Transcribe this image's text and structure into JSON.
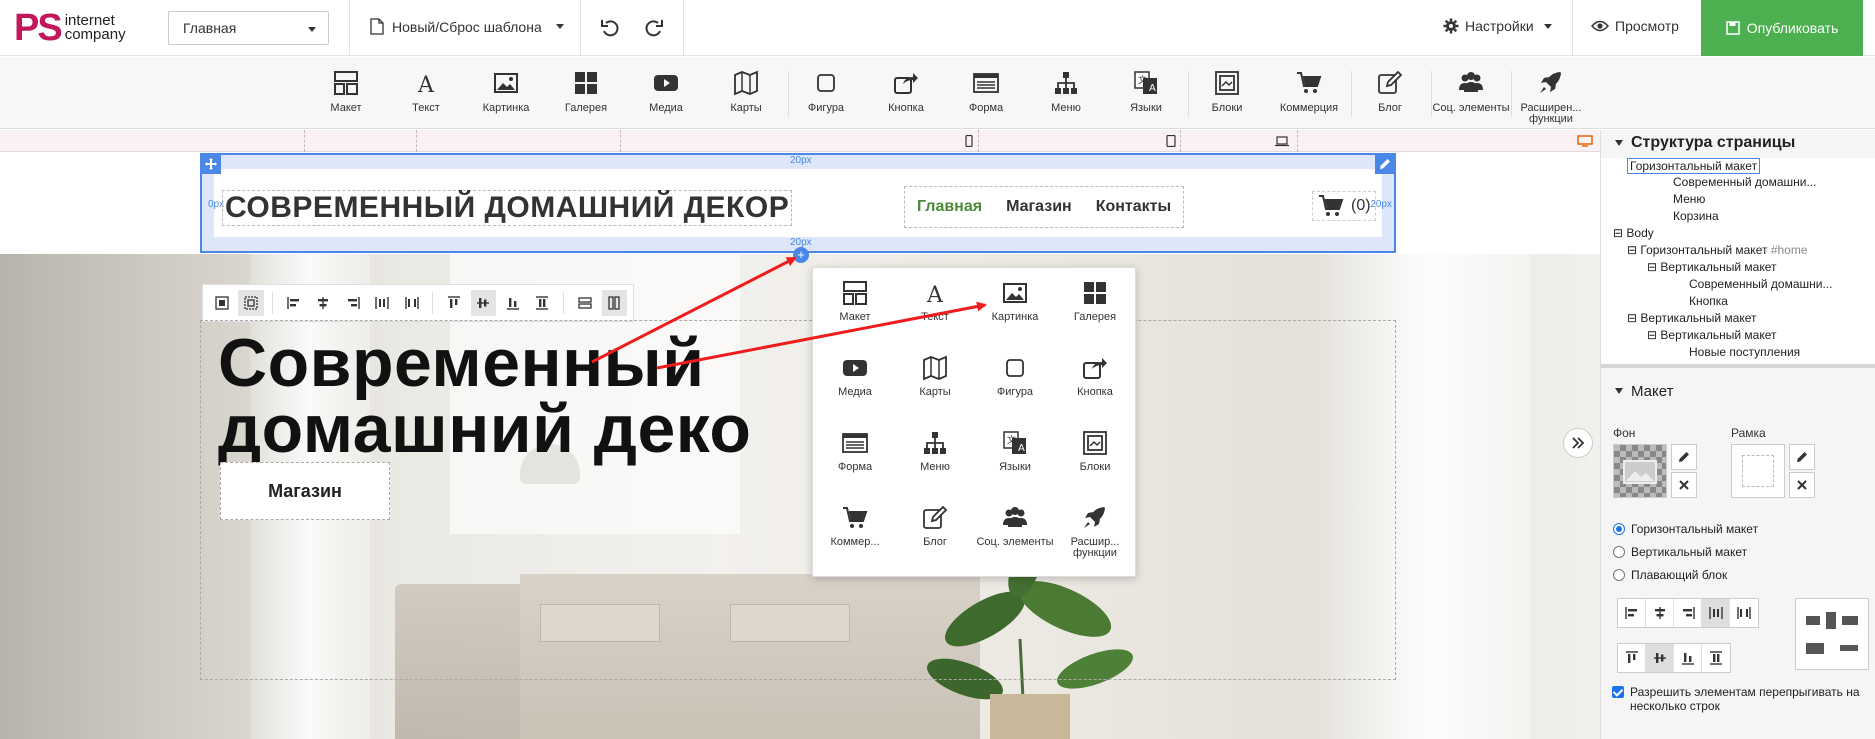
{
  "logo": {
    "mark": "PS",
    "line1": "internet",
    "line2": "company"
  },
  "topbar": {
    "page_select": "Главная",
    "template_label": "Новый/Сброс шаблона",
    "settings_label": "Настройки",
    "preview_label": "Просмотр",
    "publish_label": "Опубликовать"
  },
  "toolbar": {
    "items": [
      {
        "label": "Макет",
        "icon": "layout-icon"
      },
      {
        "label": "Текст",
        "icon": "text-icon"
      },
      {
        "label": "Картинка",
        "icon": "image-icon"
      },
      {
        "label": "Галерея",
        "icon": "gallery-icon"
      },
      {
        "label": "Медиа",
        "icon": "media-icon"
      },
      {
        "label": "Карты",
        "icon": "map-icon"
      },
      {
        "label": "Фигура",
        "icon": "shape-icon"
      },
      {
        "label": "Кнопка",
        "icon": "button-icon"
      },
      {
        "label": "Форма",
        "icon": "form-icon"
      },
      {
        "label": "Меню",
        "icon": "menu-icon"
      },
      {
        "label": "Языки",
        "icon": "languages-icon"
      },
      {
        "label": "Блоки",
        "icon": "blocks-icon"
      },
      {
        "label": "Коммерция",
        "icon": "cart-icon"
      },
      {
        "label": "Блог",
        "icon": "blog-icon"
      },
      {
        "label": "Соц. элементы",
        "icon": "social-icon"
      },
      {
        "label": "Расширен... функции",
        "icon": "rocket-icon"
      }
    ]
  },
  "site": {
    "title": "СОВРЕМЕННЫЙ ДОМАШНИЙ ДЕКОР",
    "menu": [
      "Главная",
      "Магазин",
      "Контакты"
    ],
    "cart_count": "(0)",
    "padding_label": "20px",
    "padding_label_short": "0px",
    "hero_line1": "Современный",
    "hero_line2": "домашний деко",
    "hero_button": "Магазин"
  },
  "popup": {
    "items": [
      {
        "label": "Макет",
        "icon": "layout-icon"
      },
      {
        "label": "Текст",
        "icon": "text-icon"
      },
      {
        "label": "Картинка",
        "icon": "image-icon"
      },
      {
        "label": "Галерея",
        "icon": "gallery-icon"
      },
      {
        "label": "Медиа",
        "icon": "media-icon"
      },
      {
        "label": "Карты",
        "icon": "map-icon"
      },
      {
        "label": "Фигура",
        "icon": "shape-icon"
      },
      {
        "label": "Кнопка",
        "icon": "button-icon"
      },
      {
        "label": "Форма",
        "icon": "form-icon"
      },
      {
        "label": "Меню",
        "icon": "menu-icon"
      },
      {
        "label": "Языки",
        "icon": "languages-icon"
      },
      {
        "label": "Блоки",
        "icon": "blocks-icon"
      },
      {
        "label": "Коммер...",
        "icon": "cart-icon"
      },
      {
        "label": "Блог",
        "icon": "blog-icon"
      },
      {
        "label": "Соц. элементы",
        "icon": "social-icon"
      },
      {
        "label": "Расшир... функции",
        "icon": "rocket-icon"
      }
    ]
  },
  "panel": {
    "structure_title": "Структура страницы",
    "tree": [
      "Горизонтальный макет",
      "Современный домашни...",
      "Меню",
      "Корзина",
      "Body",
      "Горизонтальный макет",
      "#home",
      "Вертикальный макет",
      "Современный домашни...",
      "Кнопка",
      "Вертикальный макет",
      "Вертикальный макет",
      "Новые поступления"
    ],
    "layout_title": "Макет",
    "bg_label": "Фон",
    "frame_label": "Рамка",
    "radio": [
      "Горизонтальный макет",
      "Вертикальный макет",
      "Плавающий блок"
    ],
    "wrap_label": "Разрешить элементам перепрыгивать на несколько строк"
  },
  "colors": {
    "accent": "#4a87e6",
    "publish": "#4caf50",
    "brand": "#c2185b",
    "menu_active": "#4b8a3a",
    "arrow": "#ee1c1c"
  }
}
